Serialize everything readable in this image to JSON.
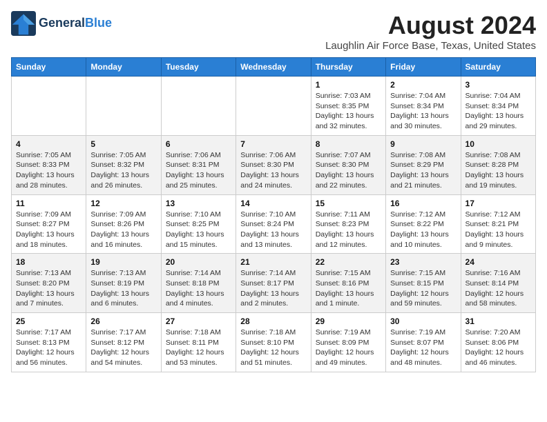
{
  "header": {
    "logo_line1": "General",
    "logo_line2": "Blue",
    "month_year": "August 2024",
    "location": "Laughlin Air Force Base, Texas, United States"
  },
  "calendar": {
    "days_of_week": [
      "Sunday",
      "Monday",
      "Tuesday",
      "Wednesday",
      "Thursday",
      "Friday",
      "Saturday"
    ],
    "weeks": [
      [
        {
          "day": "",
          "info": ""
        },
        {
          "day": "",
          "info": ""
        },
        {
          "day": "",
          "info": ""
        },
        {
          "day": "",
          "info": ""
        },
        {
          "day": "1",
          "info": "Sunrise: 7:03 AM\nSunset: 8:35 PM\nDaylight: 13 hours\nand 32 minutes."
        },
        {
          "day": "2",
          "info": "Sunrise: 7:04 AM\nSunset: 8:34 PM\nDaylight: 13 hours\nand 30 minutes."
        },
        {
          "day": "3",
          "info": "Sunrise: 7:04 AM\nSunset: 8:34 PM\nDaylight: 13 hours\nand 29 minutes."
        }
      ],
      [
        {
          "day": "4",
          "info": "Sunrise: 7:05 AM\nSunset: 8:33 PM\nDaylight: 13 hours\nand 28 minutes."
        },
        {
          "day": "5",
          "info": "Sunrise: 7:05 AM\nSunset: 8:32 PM\nDaylight: 13 hours\nand 26 minutes."
        },
        {
          "day": "6",
          "info": "Sunrise: 7:06 AM\nSunset: 8:31 PM\nDaylight: 13 hours\nand 25 minutes."
        },
        {
          "day": "7",
          "info": "Sunrise: 7:06 AM\nSunset: 8:30 PM\nDaylight: 13 hours\nand 24 minutes."
        },
        {
          "day": "8",
          "info": "Sunrise: 7:07 AM\nSunset: 8:30 PM\nDaylight: 13 hours\nand 22 minutes."
        },
        {
          "day": "9",
          "info": "Sunrise: 7:08 AM\nSunset: 8:29 PM\nDaylight: 13 hours\nand 21 minutes."
        },
        {
          "day": "10",
          "info": "Sunrise: 7:08 AM\nSunset: 8:28 PM\nDaylight: 13 hours\nand 19 minutes."
        }
      ],
      [
        {
          "day": "11",
          "info": "Sunrise: 7:09 AM\nSunset: 8:27 PM\nDaylight: 13 hours\nand 18 minutes."
        },
        {
          "day": "12",
          "info": "Sunrise: 7:09 AM\nSunset: 8:26 PM\nDaylight: 13 hours\nand 16 minutes."
        },
        {
          "day": "13",
          "info": "Sunrise: 7:10 AM\nSunset: 8:25 PM\nDaylight: 13 hours\nand 15 minutes."
        },
        {
          "day": "14",
          "info": "Sunrise: 7:10 AM\nSunset: 8:24 PM\nDaylight: 13 hours\nand 13 minutes."
        },
        {
          "day": "15",
          "info": "Sunrise: 7:11 AM\nSunset: 8:23 PM\nDaylight: 13 hours\nand 12 minutes."
        },
        {
          "day": "16",
          "info": "Sunrise: 7:12 AM\nSunset: 8:22 PM\nDaylight: 13 hours\nand 10 minutes."
        },
        {
          "day": "17",
          "info": "Sunrise: 7:12 AM\nSunset: 8:21 PM\nDaylight: 13 hours\nand 9 minutes."
        }
      ],
      [
        {
          "day": "18",
          "info": "Sunrise: 7:13 AM\nSunset: 8:20 PM\nDaylight: 13 hours\nand 7 minutes."
        },
        {
          "day": "19",
          "info": "Sunrise: 7:13 AM\nSunset: 8:19 PM\nDaylight: 13 hours\nand 6 minutes."
        },
        {
          "day": "20",
          "info": "Sunrise: 7:14 AM\nSunset: 8:18 PM\nDaylight: 13 hours\nand 4 minutes."
        },
        {
          "day": "21",
          "info": "Sunrise: 7:14 AM\nSunset: 8:17 PM\nDaylight: 13 hours\nand 2 minutes."
        },
        {
          "day": "22",
          "info": "Sunrise: 7:15 AM\nSunset: 8:16 PM\nDaylight: 13 hours\nand 1 minute."
        },
        {
          "day": "23",
          "info": "Sunrise: 7:15 AM\nSunset: 8:15 PM\nDaylight: 12 hours\nand 59 minutes."
        },
        {
          "day": "24",
          "info": "Sunrise: 7:16 AM\nSunset: 8:14 PM\nDaylight: 12 hours\nand 58 minutes."
        }
      ],
      [
        {
          "day": "25",
          "info": "Sunrise: 7:17 AM\nSunset: 8:13 PM\nDaylight: 12 hours\nand 56 minutes."
        },
        {
          "day": "26",
          "info": "Sunrise: 7:17 AM\nSunset: 8:12 PM\nDaylight: 12 hours\nand 54 minutes."
        },
        {
          "day": "27",
          "info": "Sunrise: 7:18 AM\nSunset: 8:11 PM\nDaylight: 12 hours\nand 53 minutes."
        },
        {
          "day": "28",
          "info": "Sunrise: 7:18 AM\nSunset: 8:10 PM\nDaylight: 12 hours\nand 51 minutes."
        },
        {
          "day": "29",
          "info": "Sunrise: 7:19 AM\nSunset: 8:09 PM\nDaylight: 12 hours\nand 49 minutes."
        },
        {
          "day": "30",
          "info": "Sunrise: 7:19 AM\nSunset: 8:07 PM\nDaylight: 12 hours\nand 48 minutes."
        },
        {
          "day": "31",
          "info": "Sunrise: 7:20 AM\nSunset: 8:06 PM\nDaylight: 12 hours\nand 46 minutes."
        }
      ]
    ]
  }
}
